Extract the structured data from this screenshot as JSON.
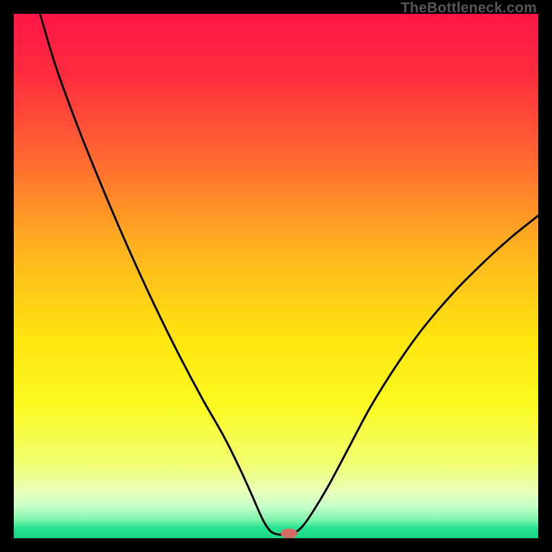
{
  "watermark": "TheBottleneck.com",
  "chart_data": {
    "type": "line",
    "title": "",
    "xlabel": "",
    "ylabel": "",
    "xlim": [
      0,
      100
    ],
    "ylim": [
      0,
      100
    ],
    "background_gradient": {
      "stops": [
        {
          "offset": 0,
          "color": "#ff1646"
        },
        {
          "offset": 12,
          "color": "#ff2d3e"
        },
        {
          "offset": 28,
          "color": "#ff6a30"
        },
        {
          "offset": 45,
          "color": "#ffb41f"
        },
        {
          "offset": 62,
          "color": "#ffe50e"
        },
        {
          "offset": 75,
          "color": "#fbfb23"
        },
        {
          "offset": 86,
          "color": "#f1ff74"
        },
        {
          "offset": 91,
          "color": "#e8ffb8"
        },
        {
          "offset": 94,
          "color": "#c7ffca"
        },
        {
          "offset": 96.5,
          "color": "#7cf6ad"
        },
        {
          "offset": 98,
          "color": "#28e28f"
        },
        {
          "offset": 100,
          "color": "#17d984"
        }
      ]
    },
    "series": [
      {
        "name": "bottleneck-curve",
        "color": "#000000",
        "points": [
          {
            "x": 5.0,
            "y": 100.0
          },
          {
            "x": 8.0,
            "y": 90.0
          },
          {
            "x": 12.0,
            "y": 79.0
          },
          {
            "x": 16.0,
            "y": 69.0
          },
          {
            "x": 20.0,
            "y": 59.5
          },
          {
            "x": 24.0,
            "y": 50.5
          },
          {
            "x": 28.0,
            "y": 42.0
          },
          {
            "x": 32.0,
            "y": 34.0
          },
          {
            "x": 36.0,
            "y": 26.5
          },
          {
            "x": 40.0,
            "y": 19.5
          },
          {
            "x": 43.0,
            "y": 13.5
          },
          {
            "x": 45.5,
            "y": 8.0
          },
          {
            "x": 47.5,
            "y": 3.5
          },
          {
            "x": 49.0,
            "y": 1.3
          },
          {
            "x": 50.5,
            "y": 0.7
          },
          {
            "x": 52.0,
            "y": 0.7
          },
          {
            "x": 53.5,
            "y": 1.0
          },
          {
            "x": 55.0,
            "y": 2.2
          },
          {
            "x": 57.0,
            "y": 5.0
          },
          {
            "x": 60.0,
            "y": 10.0
          },
          {
            "x": 64.0,
            "y": 17.5
          },
          {
            "x": 68.0,
            "y": 25.0
          },
          {
            "x": 73.0,
            "y": 33.0
          },
          {
            "x": 78.0,
            "y": 40.0
          },
          {
            "x": 84.0,
            "y": 47.0
          },
          {
            "x": 90.0,
            "y": 53.0
          },
          {
            "x": 95.0,
            "y": 57.5
          },
          {
            "x": 100.0,
            "y": 61.5
          }
        ]
      }
    ],
    "marker": {
      "name": "optimal-point",
      "x": 52.5,
      "y": 0.9,
      "color": "#d36a63",
      "rx": 1.6,
      "ry": 0.95
    }
  }
}
